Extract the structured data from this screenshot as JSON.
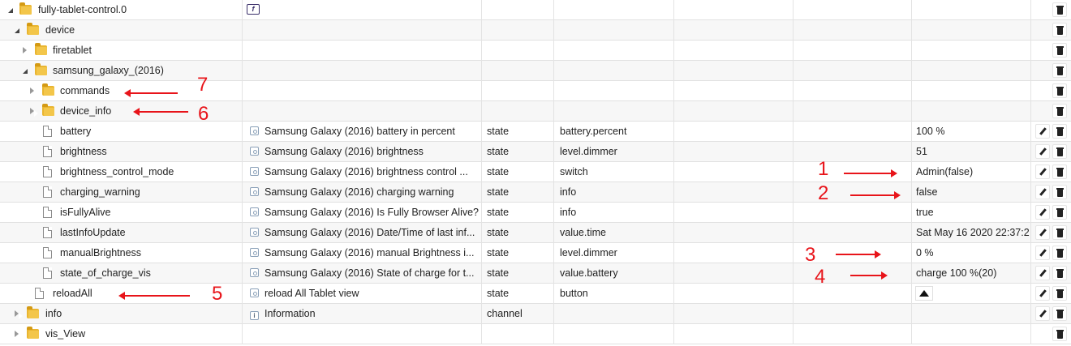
{
  "rows": [
    {
      "name": "fully-tablet-control.0",
      "desc": "",
      "type": "",
      "role": "",
      "value": ""
    },
    {
      "name": "device",
      "desc": "",
      "type": "",
      "role": "",
      "value": ""
    },
    {
      "name": "firetablet",
      "desc": "",
      "type": "",
      "role": "",
      "value": ""
    },
    {
      "name": "samsung_galaxy_(2016)",
      "desc": "",
      "type": "",
      "role": "",
      "value": ""
    },
    {
      "name": "commands",
      "desc": "",
      "type": "",
      "role": "",
      "value": ""
    },
    {
      "name": "device_info",
      "desc": "",
      "type": "",
      "role": "",
      "value": ""
    },
    {
      "name": "battery",
      "desc": "Samsung Galaxy (2016) battery in percent",
      "type": "state",
      "role": "battery.percent",
      "value": "100 %"
    },
    {
      "name": "brightness",
      "desc": "Samsung Galaxy (2016) brightness",
      "type": "state",
      "role": "level.dimmer",
      "value": "51"
    },
    {
      "name": "brightness_control_mode",
      "desc": "Samsung Galaxy (2016) brightness control ...",
      "type": "state",
      "role": "switch",
      "value": "Admin(false)"
    },
    {
      "name": "charging_warning",
      "desc": "Samsung Galaxy (2016) charging warning",
      "type": "state",
      "role": "info",
      "value": "false"
    },
    {
      "name": "isFullyAlive",
      "desc": "Samsung Galaxy (2016) Is Fully Browser Alive?",
      "type": "state",
      "role": "info",
      "value": "true"
    },
    {
      "name": "lastInfoUpdate",
      "desc": "Samsung Galaxy (2016) Date/Time of last inf...",
      "type": "state",
      "role": "value.time",
      "value": "Sat May 16 2020 22:37:2"
    },
    {
      "name": "manualBrightness",
      "desc": "Samsung Galaxy (2016) manual Brightness i...",
      "type": "state",
      "role": "level.dimmer",
      "value": "0 %"
    },
    {
      "name": "state_of_charge_vis",
      "desc": "Samsung Galaxy (2016) State of charge for t...",
      "type": "state",
      "role": "value.battery",
      "value": "charge 100 %(20)"
    },
    {
      "name": "reloadAll",
      "desc": "reload All Tablet view",
      "type": "state",
      "role": "button",
      "value": ""
    },
    {
      "name": "info",
      "desc": "Information",
      "type": "channel",
      "role": "",
      "value": ""
    },
    {
      "name": "vis_View",
      "desc": "",
      "type": "",
      "role": "",
      "value": ""
    }
  ],
  "adapter_icon_letter": "f",
  "annotations": [
    "1",
    "2",
    "3",
    "4",
    "5",
    "6",
    "7"
  ],
  "colors": {
    "annotation": "#e8141a",
    "folder": "#e9b530"
  }
}
